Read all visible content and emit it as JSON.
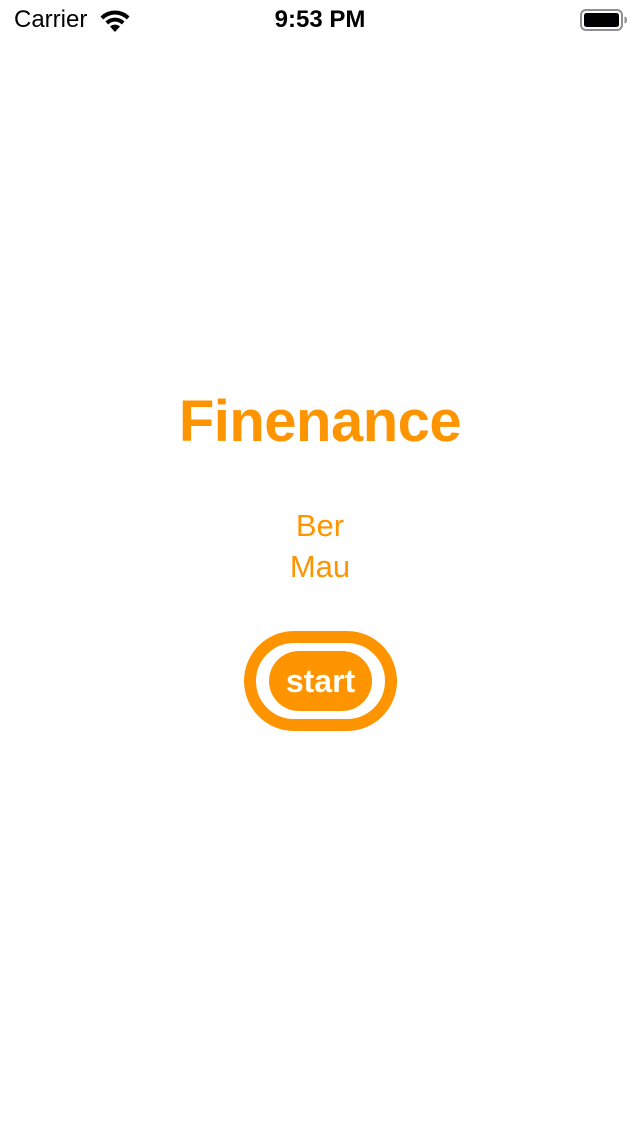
{
  "status_bar": {
    "carrier": "Carrier",
    "time": "9:53 PM"
  },
  "main": {
    "title": "Finenance",
    "authors": [
      "Ber",
      "Mau"
    ],
    "start_label": "start"
  },
  "colors": {
    "accent": "#fe9500",
    "background": "#ffffff"
  }
}
